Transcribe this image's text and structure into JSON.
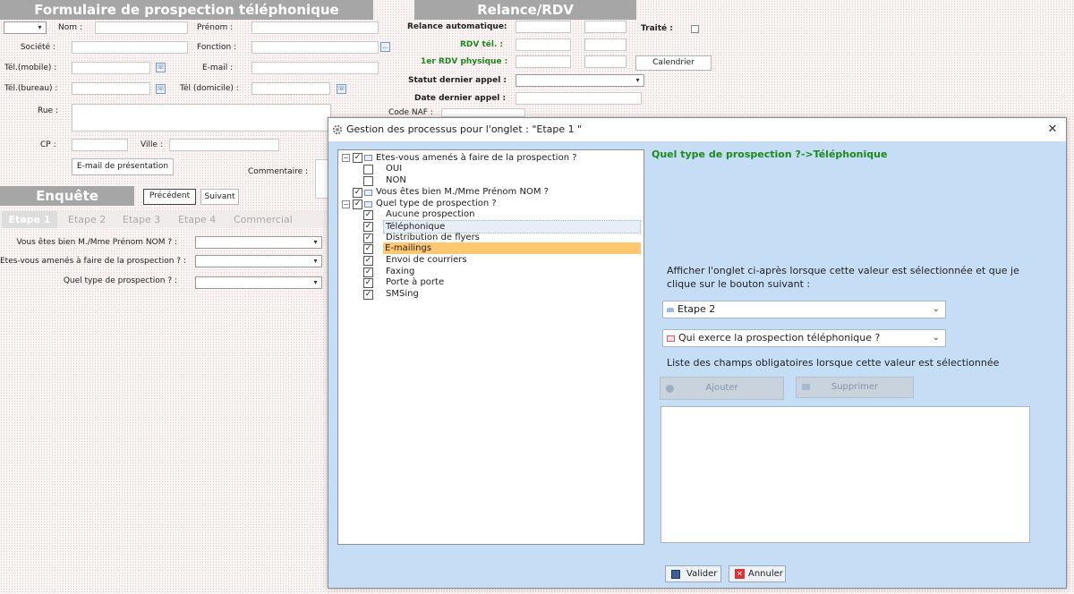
{
  "form": {
    "banner_title": "Formulaire de prospection téléphonique",
    "nom": "Nom :",
    "prenom": "Prénom :",
    "societe": "Société :",
    "fonction": "Fonction :",
    "tel_mobile": "Tél.(mobile) :",
    "email": "E-mail :",
    "tel_bureau": "Tél.(bureau) :",
    "tel_domicile": "Tél (domicile) :",
    "rue": "Rue :",
    "cp": "CP :",
    "ville": "Ville :",
    "email_presentation": "E-mail de présentation",
    "commentaire": "Commentaire :",
    "code_naf": "Code NAF :",
    "ellipsis": "...",
    "phone_glyph": "☏"
  },
  "relance": {
    "banner_title": "Relance/RDV",
    "relance_auto": "Relance automatique:",
    "traite": "Traité :",
    "rdv_tel": "RDV tél. :",
    "rdv_physique": "1er RDV physique :",
    "calendrier": "Calendrier",
    "statut_dernier_appel": "Statut dernier appel :",
    "date_dernier_appel": "Date dernier appel :"
  },
  "enquete": {
    "banner_title": "Enquête",
    "precedent": "Précédent",
    "suivant": "Suivant",
    "tabs": [
      "Etape 1",
      "Etape 2",
      "Etape 3",
      "Etape 4",
      "Commercial"
    ],
    "q1": "Vous êtes bien M./Mme Prénom NOM ? :",
    "q2": "Etes-vous amenés à faire de la prospection ? :",
    "q3": "Quel type de prospection ? :"
  },
  "dialog": {
    "title": "Gestion des processus pour l'onglet : \"Etape 1 \"",
    "close": "✕",
    "path_title": "Quel type de prospection ?->Téléphonique",
    "description": "Afficher l'onglet ci-après lorsque cette valeur est sélectionnée et que je clique sur le bouton suivant :",
    "combo_tab": "Etape 2",
    "combo_question": "Qui exerce la prospection téléphonique ?",
    "required_fields": "Liste des champs obligatoires lorsque cette valeur est sélectionnée",
    "ajouter": "Ajouter",
    "supprimer": "Supprimer",
    "valider": "Valider",
    "annuler": "Annuler"
  },
  "tree": {
    "q1": "Etes-vous amenés à faire de la prospection ?",
    "q1_opts": [
      "OUI",
      "NON"
    ],
    "q2": "Vous êtes bien M./Mme Prénom NOM ?",
    "q3": "Quel type de prospection ?",
    "q3_opts": [
      "Aucune prospection",
      "Téléphonique",
      "Distribution de flyers",
      "E-mailings",
      "Envoi de courriers",
      "Faxing",
      "Porte à porte",
      "SMSing"
    ]
  },
  "glyphs": {
    "check": "✓",
    "minus": "−",
    "arrow_down": "⌄",
    "combo_arrow": "▾"
  },
  "colors": {
    "accent_green": "#1b8a1b",
    "dialog_bg": "#c6ddf6",
    "selected_orange": "#ffc870"
  }
}
